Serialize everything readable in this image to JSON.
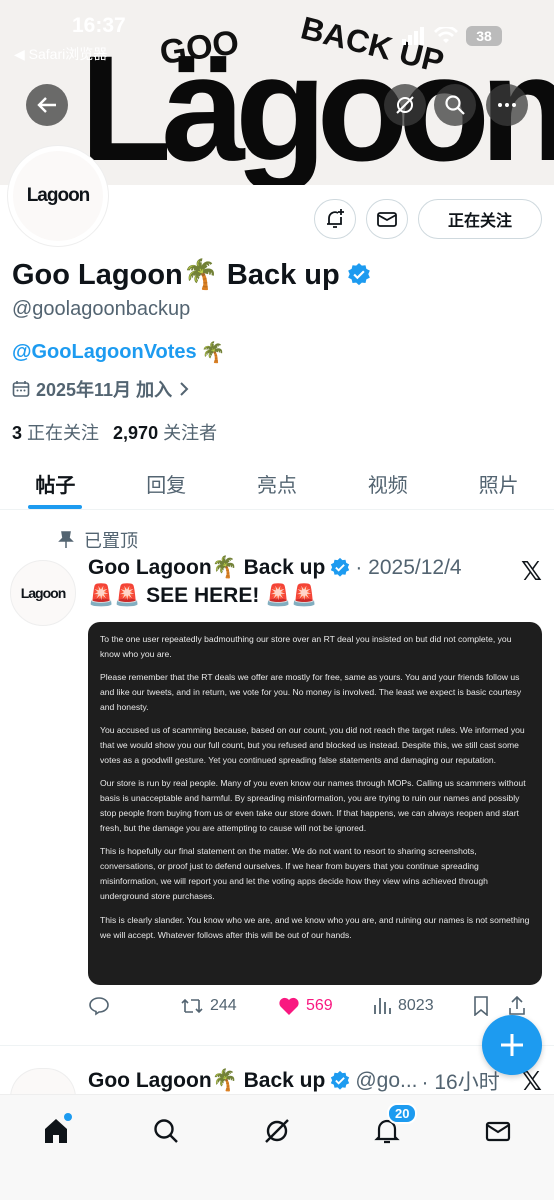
{
  "status_bar": {
    "time": "16:37",
    "back_app": "◀ Safari浏览器",
    "battery": "38"
  },
  "banner": {
    "text_top": "GOO",
    "text_right": "BACK UP",
    "text_main": "Lägoon"
  },
  "avatar": {
    "text": "Lagoon"
  },
  "actions": {
    "follow_label": "正在关注"
  },
  "profile": {
    "display_name": "Goo Lagoon🌴 Back up",
    "handle": "@goolagoonbackup",
    "link": "@GooLagoonVotes",
    "link_emoji": "🌴",
    "joined": "2025年11月 加入",
    "following_count": "3",
    "following_label": "正在关注",
    "followers_count": "2,970",
    "followers_label": "关注者"
  },
  "tabs": [
    {
      "label": "帖子"
    },
    {
      "label": "回复"
    },
    {
      "label": "亮点"
    },
    {
      "label": "视频"
    },
    {
      "label": "照片"
    }
  ],
  "pinned_post": {
    "pinned_label": "已置顶",
    "name": "Goo Lagoon🌴 Back up",
    "date": "· 2025/12/4",
    "text": "🚨🚨 SEE HERE! 🚨🚨",
    "replies": "",
    "retweets": "244",
    "likes": "569",
    "views": "8023"
  },
  "notice": {
    "p1": "To the one user repeatedly badmouthing our store over an RT deal you insisted on but did not complete, you know who you are.",
    "p2": "Please remember that the RT deals we offer are mostly for free, same as yours. You and your friends follow us and like our tweets, and in return, we vote for you. No money is involved. The least we expect is basic courtesy and honesty.",
    "p3": "You accused us of scamming because, based on our count, you did not reach the target rules. We informed you that we would show you our full count, but you refused and blocked us instead. Despite this, we still cast some votes as a goodwill gesture. Yet you continued spreading false statements and damaging our reputation.",
    "p4": "Our store is run by real people. Many of you even know our names through MOPs. Calling us scammers without basis is unacceptable and harmful. By spreading misinformation, you are trying to ruin our names and possibly stop people from buying from us or even take our store down. If that happens, we can always reopen and start fresh, but the damage you are attempting to cause will not be ignored.",
    "p5": "This is hopefully our final statement on the matter. We do not want to resort to sharing screenshots, conversations, or proof just to defend ourselves. If we hear from buyers that you continue spreading misinformation, we will report you and let the voting apps decide how they view wins achieved through underground store purchases.",
    "p6": "This is clearly slander. You know who we are, and we know who you are, and ruining our names is not something we will accept. Whatever follows after this will be out of our hands."
  },
  "second_post": {
    "name": "Goo Lagoon🌴 Back up",
    "handle": "@go...",
    "time": "· 16小时"
  },
  "nav": {
    "notifications_badge": "20"
  },
  "colors": {
    "accent": "#1d9bf0",
    "like": "#f91880"
  }
}
